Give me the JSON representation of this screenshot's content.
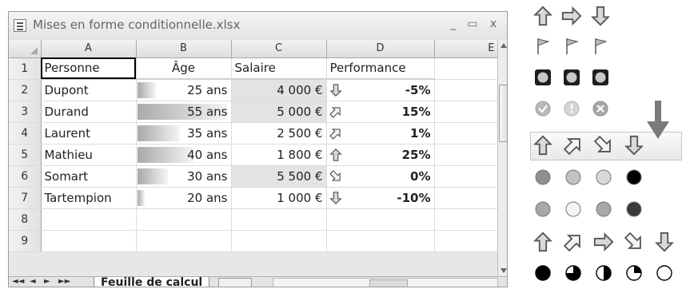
{
  "window": {
    "title": "Mises en forme conditionnelle.xlsx",
    "min_symbol": "_",
    "max_symbol": "▭",
    "close_symbol": "x"
  },
  "columns": [
    "A",
    "B",
    "C",
    "D",
    "E"
  ],
  "rows": [
    {
      "num": "1",
      "a": "Personne",
      "b": "Âge",
      "c": "Salaire",
      "d": "Performance"
    },
    {
      "num": "2",
      "a": "Dupont",
      "b": "25 ans",
      "c": "4 000 €",
      "d": "-5%",
      "icon": "arrow-down",
      "age_fill": 0.2,
      "salary_hl": true
    },
    {
      "num": "3",
      "a": "Durand",
      "b": "55 ans",
      "c": "5 000 €",
      "d": "15%",
      "icon": "arrow-up-right",
      "age_fill": 0.95,
      "salary_hl": true
    },
    {
      "num": "4",
      "a": "Laurent",
      "b": "35 ans",
      "c": "2 500 €",
      "d": "1%",
      "icon": "arrow-up-right",
      "age_fill": 0.45,
      "salary_hl": false
    },
    {
      "num": "5",
      "a": "Mathieu",
      "b": "40 ans",
      "c": "1 800 €",
      "d": "25%",
      "icon": "arrow-up",
      "age_fill": 0.6,
      "salary_hl": false
    },
    {
      "num": "6",
      "a": "Somart",
      "b": "30 ans",
      "c": "5 500 €",
      "d": "0%",
      "icon": "arrow-down-right",
      "age_fill": 0.33,
      "salary_hl": true
    },
    {
      "num": "7",
      "a": "Tartempion",
      "b": "20 ans",
      "c": "1 000 €",
      "d": "-10%",
      "icon": "arrow-down",
      "age_fill": 0.08,
      "salary_hl": false
    },
    {
      "num": "8"
    },
    {
      "num": "9"
    }
  ],
  "sheet": {
    "tab_label": "Feuille de calcul",
    "nav": [
      "◄◄",
      "◄",
      "►",
      "►►"
    ]
  },
  "icon_sets": [
    {
      "name": "3-arrows",
      "icons": [
        "arrow-up-outline",
        "arrow-right-outline",
        "arrow-down-outline"
      ]
    },
    {
      "name": "3-flags",
      "icons": [
        "flag",
        "flag",
        "flag"
      ]
    },
    {
      "name": "3-traffic-lights",
      "icons": [
        "traffic-light",
        "traffic-light",
        "traffic-light"
      ]
    },
    {
      "name": "3-symbols",
      "icons": [
        "check-circle",
        "exclamation-circle",
        "x-circle"
      ]
    },
    {
      "name": "4-arrows-gray",
      "icons": [
        "arrow-up-outline",
        "arrow-up-right-outline",
        "arrow-down-right-outline",
        "arrow-down-outline"
      ]
    },
    {
      "name": "4-ratings-red-to-black",
      "icons": [
        "circle-dark-gray",
        "circle-light-gray",
        "circle-lighter-gray",
        "circle-black"
      ]
    },
    {
      "name": "4-traffic-lights",
      "icons": [
        "circle-gray",
        "circle-white",
        "circle-gray",
        "circle-dark"
      ]
    },
    {
      "name": "5-arrows",
      "icons": [
        "arrow-up-outline",
        "arrow-up-right-outline",
        "arrow-right-outline",
        "arrow-down-right-outline",
        "arrow-down-outline"
      ]
    },
    {
      "name": "5-quarters",
      "icons": [
        "quarter-full",
        "quarter-3",
        "quarter-half",
        "quarter-1",
        "quarter-empty"
      ]
    }
  ],
  "colors": {
    "fill_gray": "#8c8c8c",
    "highlight_cell": "#e3e3e3",
    "pointer": "#7a7a7a"
  }
}
